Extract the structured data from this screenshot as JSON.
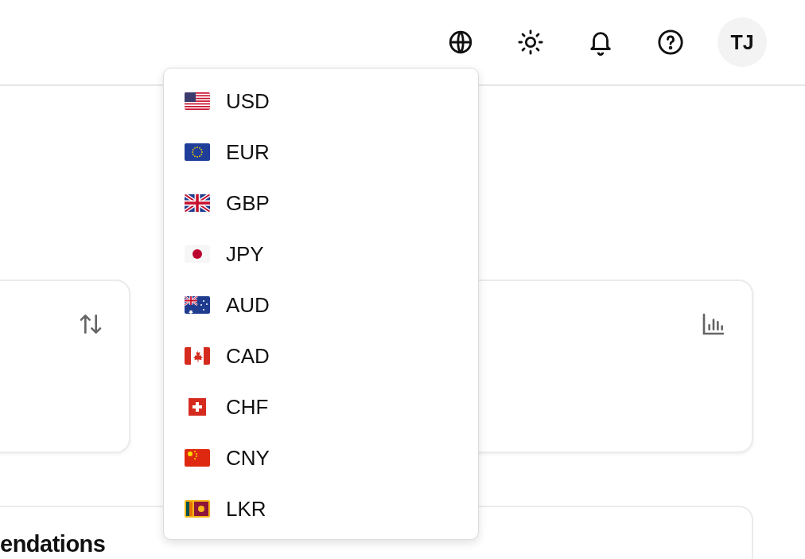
{
  "header": {
    "avatar": {
      "initials": "TJ"
    }
  },
  "currency_menu": {
    "items": [
      {
        "code": "USD",
        "kind": "us"
      },
      {
        "code": "EUR",
        "kind": "eu"
      },
      {
        "code": "GBP",
        "kind": "gb"
      },
      {
        "code": "JPY",
        "kind": "jp"
      },
      {
        "code": "AUD",
        "kind": "au"
      },
      {
        "code": "CAD",
        "kind": "ca"
      },
      {
        "code": "CHF",
        "kind": "ch"
      },
      {
        "code": "CNY",
        "kind": "cn"
      },
      {
        "code": "LKR",
        "kind": "lk"
      }
    ]
  },
  "bottom_card": {
    "title": "endations"
  }
}
